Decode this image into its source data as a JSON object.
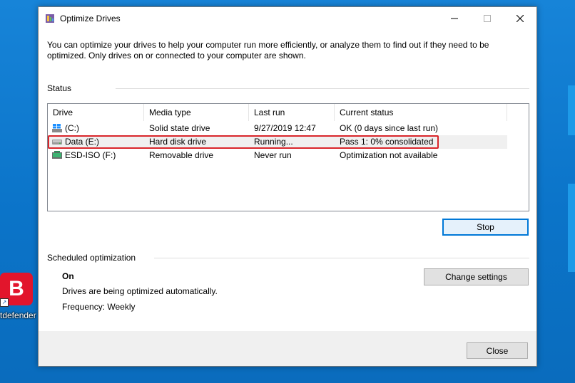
{
  "desktop": {
    "shortcut_label": "tdefender",
    "shortcut_letter": "B"
  },
  "window": {
    "title": "Optimize Drives",
    "intro_text": "You can optimize your drives to help your computer run more efficiently, or analyze them to find out if they need to be optimized. Only drives on or connected to your computer are shown.",
    "status_label": "Status",
    "columns": [
      "Drive",
      "Media type",
      "Last run",
      "Current status"
    ],
    "drives": [
      {
        "drive": "(C:)",
        "media": "Solid state drive",
        "last_run": "9/27/2019 12:47",
        "status": "OK (0 days since last run)",
        "icon": "windows-drive-icon"
      },
      {
        "drive": "Data (E:)",
        "media": "Hard disk drive",
        "last_run": "Running...",
        "status": "Pass 1: 0% consolidated",
        "icon": "hard-disk-icon"
      },
      {
        "drive": "ESD-ISO (F:)",
        "media": "Removable drive",
        "last_run": "Never run",
        "status": "Optimization not available",
        "icon": "removable-drive-icon"
      }
    ],
    "stop_button": "Stop",
    "scheduled_label": "Scheduled optimization",
    "schedule_state": "On",
    "schedule_desc": "Drives are being optimized automatically.",
    "schedule_freq": "Frequency: Weekly",
    "change_settings_button": "Change settings",
    "close_button": "Close"
  },
  "colors": {
    "desktop_bg": "#0b74c9",
    "highlight": "#d9252a",
    "accent": "#0078d7",
    "bitdefender_red": "#e2152c"
  }
}
